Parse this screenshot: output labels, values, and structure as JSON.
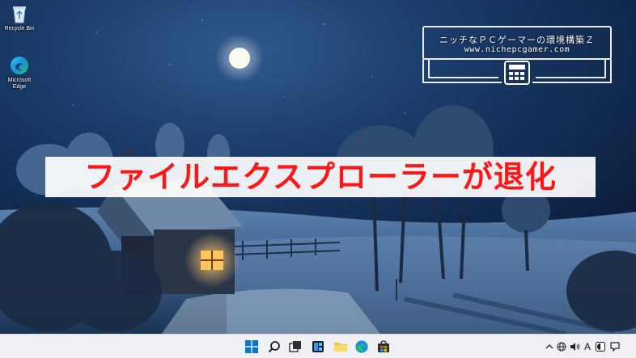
{
  "desktop": {
    "icons": [
      {
        "label": "Recycle Bin",
        "icon": "recycle-bin-icon"
      },
      {
        "label": "Microsoft\nEdge",
        "line1": "Microsoft",
        "line2": "Edge",
        "icon": "edge-icon"
      }
    ]
  },
  "watermark": {
    "title": "ニッチなＰＣゲーマーの環境構築Ｚ",
    "url": "www.nichepcgamer.com"
  },
  "headline": {
    "text": "ファイルエクスプローラーが退化",
    "color": "#ff1616"
  },
  "taskbar": {
    "apps": [
      {
        "name": "start",
        "icon": "windows-start-icon"
      },
      {
        "name": "search",
        "icon": "search-icon"
      },
      {
        "name": "task-view",
        "icon": "task-view-icon"
      },
      {
        "name": "widgets",
        "icon": "widgets-icon"
      },
      {
        "name": "file-explorer",
        "icon": "folder-icon"
      },
      {
        "name": "edge",
        "icon": "edge-icon"
      },
      {
        "name": "store",
        "icon": "store-icon"
      }
    ],
    "tray": {
      "chevron": "^",
      "ime_indicator": "A"
    },
    "accent": "#0078d4"
  }
}
